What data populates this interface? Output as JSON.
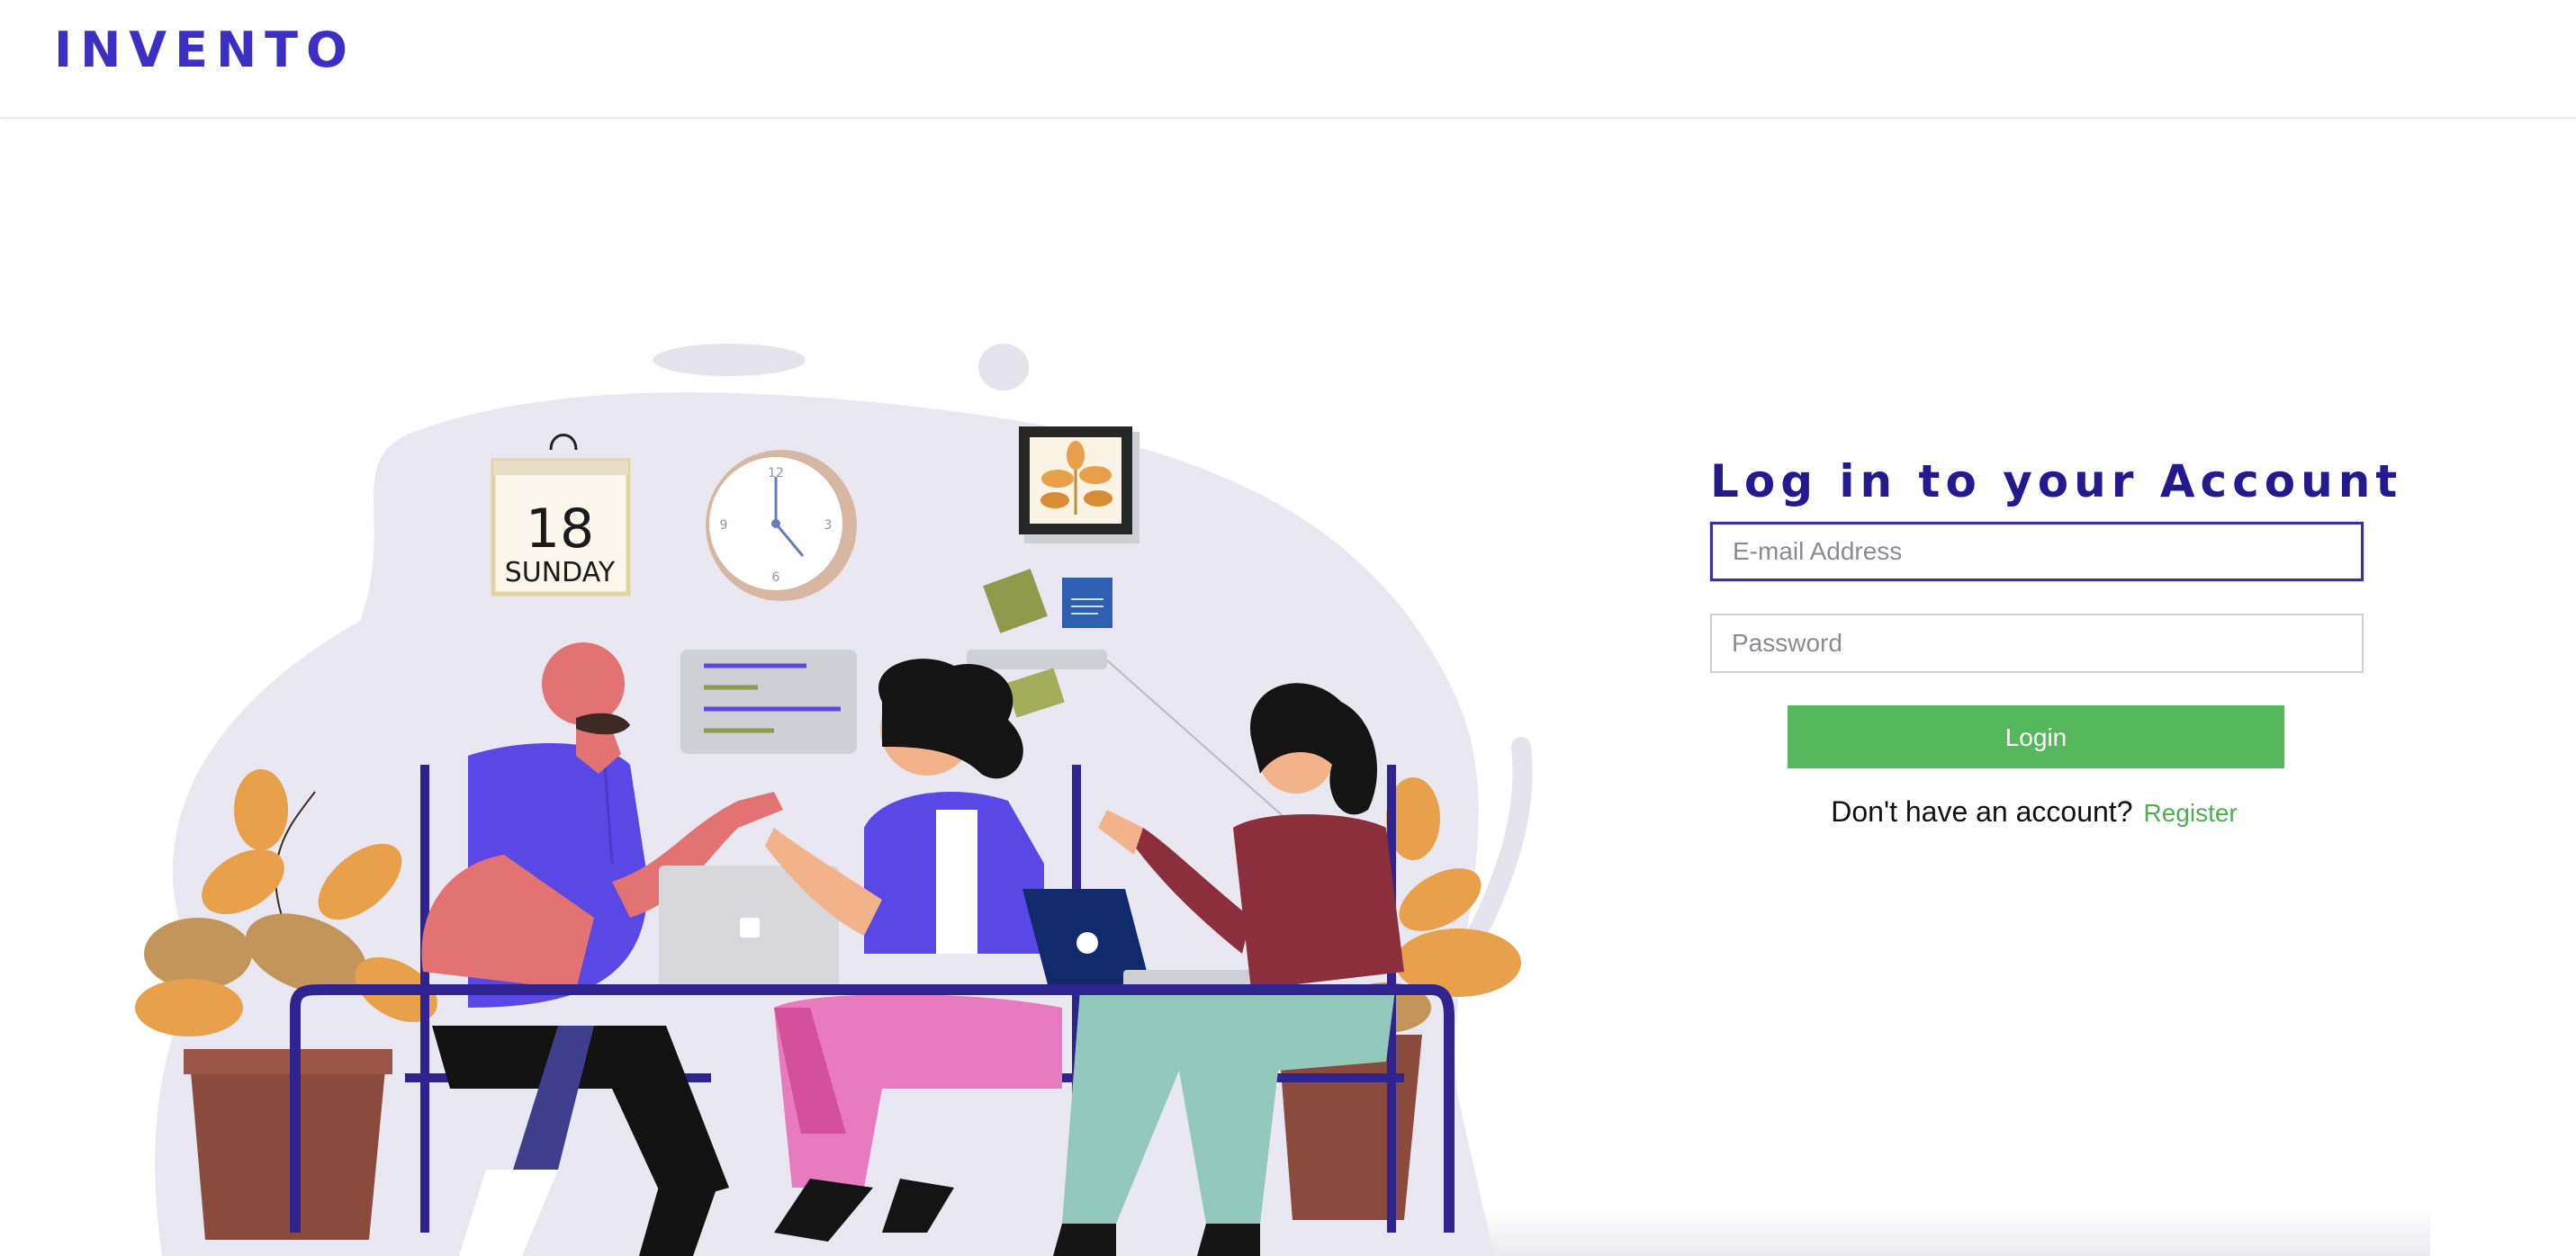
{
  "header": {
    "logo_text": "INVENTO"
  },
  "illustration": {
    "calendar_day": "18",
    "calendar_weekday": "SUNDAY",
    "clock_numbers": [
      "12",
      "3",
      "6",
      "9"
    ]
  },
  "login": {
    "title": "Log in to your Account",
    "email_placeholder": "E-mail Address",
    "email_value": "",
    "password_placeholder": "Password",
    "password_value": "",
    "button_label": "Login",
    "no_account_text": "Don't have an account?",
    "register_label": "Register"
  },
  "colors": {
    "brand": "#3b2fc4",
    "title": "#241a8f",
    "button": "#55b85d",
    "link": "#4caf50",
    "focus_border": "#3f2aa8"
  },
  "icons": [
    "laptop-icon"
  ]
}
